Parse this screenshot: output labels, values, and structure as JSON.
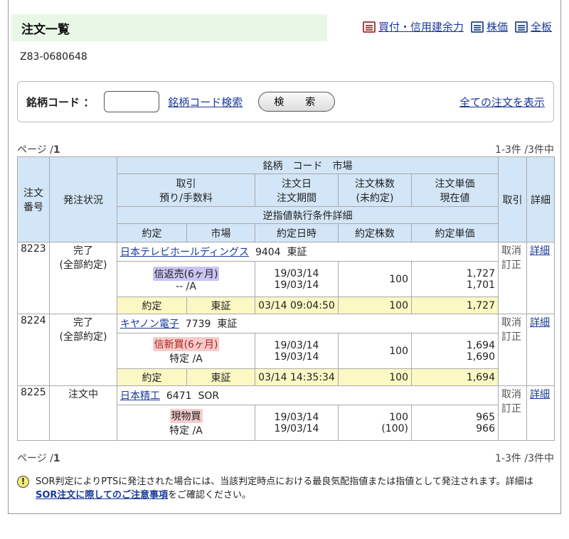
{
  "page": {
    "title": "注文一覧",
    "account_id": "Z83-0680648"
  },
  "header_links": {
    "buying_power": "買付・信用建余力",
    "price": "株価",
    "full_board": "全板"
  },
  "search": {
    "label": "銘柄コード ：",
    "input_value": "",
    "code_search_link": "銘柄コード検索",
    "button": "検　索",
    "show_all_link": "全ての注文を表示"
  },
  "pager": {
    "prefix": "ページ /",
    "page": "1",
    "count": "1-3件 /3件中"
  },
  "table_headers": {
    "order_no": "注文\n番号",
    "status": "発注状況",
    "stock_code_market": "銘柄　コード　市場",
    "trade": "取引",
    "deposit_fee": "預り/手数料",
    "order_date": "注文日",
    "order_period": "注文期間",
    "order_qty": "注文株数",
    "unfilled": "(未約定)",
    "order_price": "注文単価",
    "current_price": "現在値",
    "cancel_col": "取引",
    "detail_col": "詳細",
    "stop_condition": "逆指値執行条件詳細",
    "exec": "約定",
    "market": "市場",
    "exec_datetime": "約定日時",
    "exec_qty": "約定株数",
    "exec_price": "約定単価"
  },
  "orders": [
    {
      "no": "8223",
      "status": "完了",
      "status_sub": "(全部約定)",
      "stock": "日本テレビホールディングス",
      "code": "9404",
      "market": "東証",
      "trade": "信返売(6ヶ月)",
      "deposit": "-- /A",
      "order_date": "19/03/14",
      "order_period": "19/03/14",
      "order_qty": "100",
      "unfilled": "",
      "order_price": "1,727",
      "current_price": "1,701",
      "cancel": "取消",
      "correct": "訂正",
      "detail": "詳細",
      "exec_label": "約定",
      "exec_market": "東証",
      "exec_datetime": "03/14 09:04:50",
      "exec_qty": "100",
      "exec_price": "1,727"
    },
    {
      "no": "8224",
      "status": "完了",
      "status_sub": "(全部約定)",
      "stock": "キヤノン電子",
      "code": "7739",
      "market": "東証",
      "trade": "信新買(6ヶ月)",
      "deposit": "特定 /A",
      "order_date": "19/03/14",
      "order_period": "19/03/14",
      "order_qty": "100",
      "unfilled": "",
      "order_price": "1,694",
      "current_price": "1,690",
      "cancel": "取消",
      "correct": "訂正",
      "detail": "詳細",
      "exec_label": "約定",
      "exec_market": "東証",
      "exec_datetime": "03/14 14:35:34",
      "exec_qty": "100",
      "exec_price": "1,694"
    },
    {
      "no": "8225",
      "status": "注文中",
      "status_sub": "",
      "stock": "日本精工",
      "code": "6471",
      "market": "SOR",
      "trade": "現物買",
      "deposit": "特定 /A",
      "order_date": "19/03/14",
      "order_period": "19/03/14",
      "order_qty": "100",
      "unfilled": "(100)",
      "order_price": "965",
      "current_price": "966",
      "cancel": "取消",
      "correct": "訂正",
      "detail": "詳細"
    }
  ],
  "notice": {
    "text1": "SOR判定によりPTSに発注された場合には、当該判定時点における最良気配指値または指値として発注されます。詳細は",
    "link": "SOR注文に際してのご注意事項",
    "text2": "をご確認ください。"
  },
  "colors": {
    "title_bg": "#e9f7e7",
    "header_bg": "#d3e6f7",
    "exec_row_bg": "#fbf8c4",
    "link": "#1a3a9a"
  }
}
